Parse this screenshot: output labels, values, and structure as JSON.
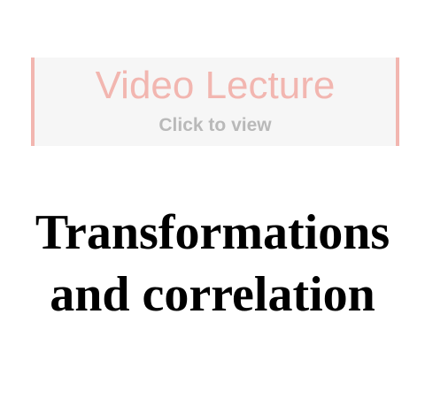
{
  "video_banner": {
    "title": "Video Lecture",
    "subtitle": "Click to view",
    "accent_color": "#f2b6b0",
    "subtitle_color": "#b9b9b9"
  },
  "page_title": {
    "line1": "Transformations",
    "line2": "and correlation"
  }
}
